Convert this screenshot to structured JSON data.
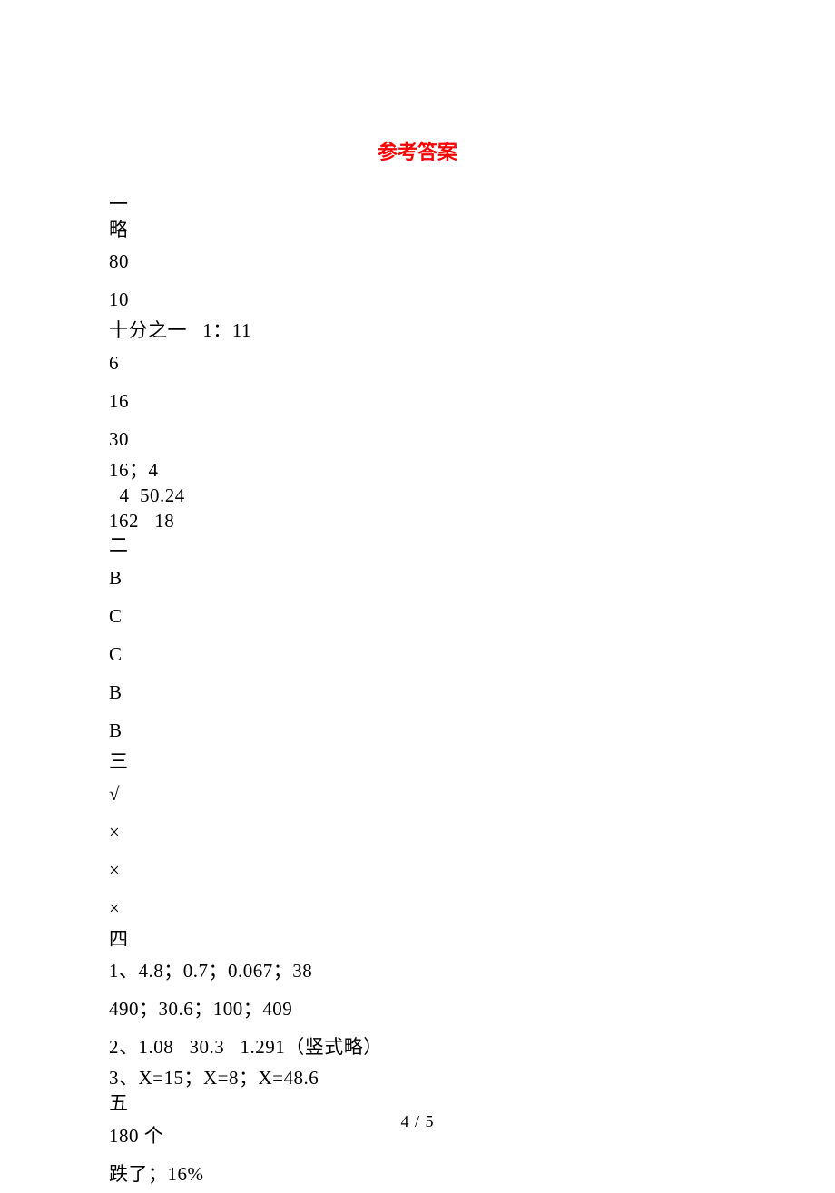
{
  "title": "参考答案",
  "lines": [
    {
      "text": "一",
      "tight": true
    },
    {
      "text": "略",
      "tight": true
    },
    {
      "text": "80"
    },
    {
      "text": "10"
    },
    {
      "text": "十分之一   1：11",
      "tight": true
    },
    {
      "text": "6"
    },
    {
      "text": "16"
    },
    {
      "text": "30"
    },
    {
      "text": "16；4",
      "tight": true
    },
    {
      "text": "  4  50.24",
      "tight": true
    },
    {
      "text": "162   18",
      "tight": true
    },
    {
      "text": "二",
      "tight": true
    },
    {
      "text": "B"
    },
    {
      "text": "C"
    },
    {
      "text": "C"
    },
    {
      "text": "B"
    },
    {
      "text": "B"
    },
    {
      "text": "三",
      "tight": true
    },
    {
      "text": "√"
    },
    {
      "text": "×"
    },
    {
      "text": "×"
    },
    {
      "text": "×"
    },
    {
      "text": "四",
      "tight": true
    },
    {
      "text": "1、4.8；0.7；0.067；38"
    },
    {
      "text": "490；30.6；100；409"
    },
    {
      "text": "2、1.08   30.3   1.291（竖式略）"
    },
    {
      "text": "3、X=15；X=8；X=48.6",
      "tight": true
    },
    {
      "text": "五",
      "tight": true
    },
    {
      "text": "180 个"
    },
    {
      "text": "跌了；16%"
    }
  ],
  "footer": "4 / 5"
}
